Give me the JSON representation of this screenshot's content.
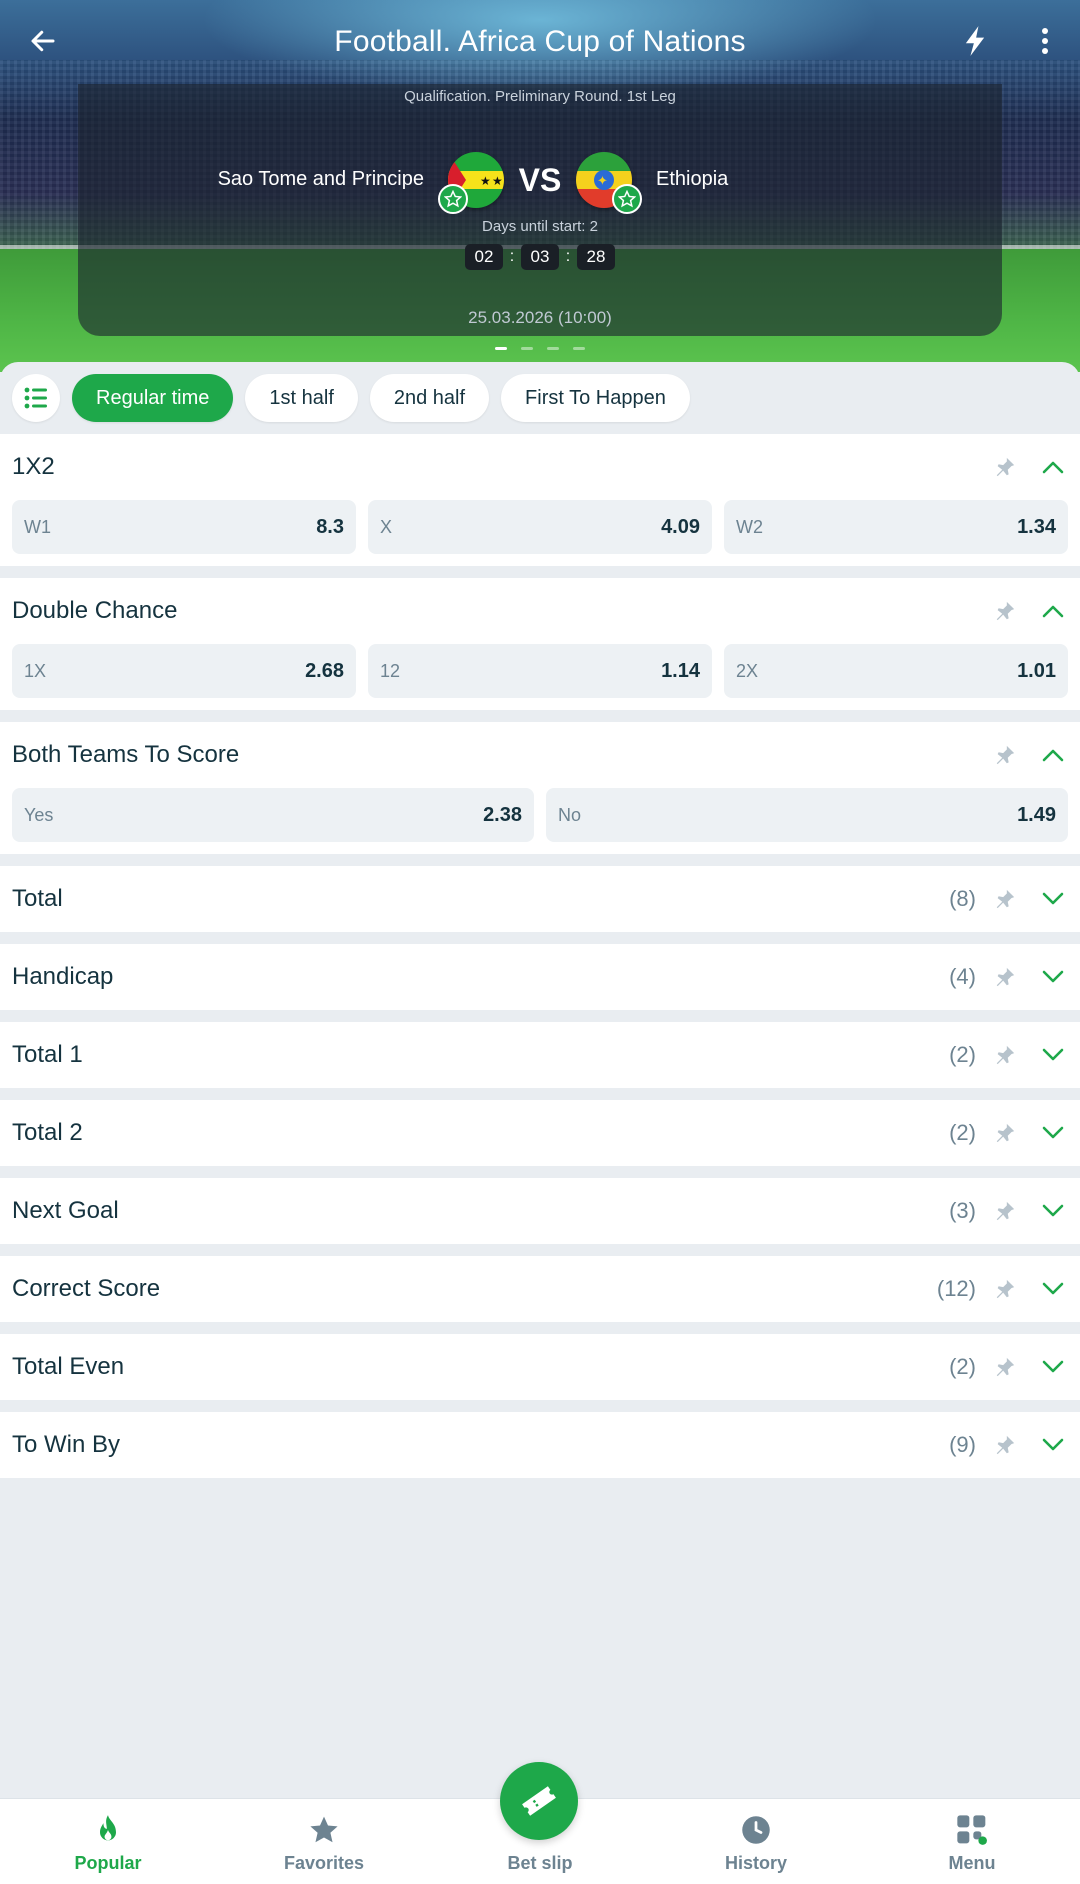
{
  "header": {
    "title": "Football. Africa Cup of Nations",
    "round": "Qualification. Preliminary Round. 1st Leg"
  },
  "match": {
    "team1": "Sao Tome and Principe",
    "team2": "Ethiopia",
    "vs": "VS",
    "days_until": "Days until start: 2",
    "countdown": [
      "02",
      "03",
      "28"
    ],
    "date": "25.03.2026 (10:00)",
    "carousel_pages": 4,
    "carousel_active": 1
  },
  "tabs": [
    {
      "label": "Regular time",
      "active": true
    },
    {
      "label": "1st half",
      "active": false
    },
    {
      "label": "2nd half",
      "active": false
    },
    {
      "label": "First To Happen",
      "active": false
    }
  ],
  "markets": [
    {
      "name": "1X2",
      "expanded": true,
      "odds": [
        {
          "label": "W1",
          "value": "8.3"
        },
        {
          "label": "X",
          "value": "4.09"
        },
        {
          "label": "W2",
          "value": "1.34"
        }
      ]
    },
    {
      "name": "Double Chance",
      "expanded": true,
      "odds": [
        {
          "label": "1X",
          "value": "2.68"
        },
        {
          "label": "12",
          "value": "1.14"
        },
        {
          "label": "2X",
          "value": "1.01"
        }
      ]
    },
    {
      "name": "Both Teams To Score",
      "expanded": true,
      "odds": [
        {
          "label": "Yes",
          "value": "2.38"
        },
        {
          "label": "No",
          "value": "1.49"
        }
      ]
    },
    {
      "name": "Total",
      "expanded": false,
      "count": "(8)"
    },
    {
      "name": "Handicap",
      "expanded": false,
      "count": "(4)"
    },
    {
      "name": "Total 1",
      "expanded": false,
      "count": "(2)"
    },
    {
      "name": "Total 2",
      "expanded": false,
      "count": "(2)"
    },
    {
      "name": "Next Goal",
      "expanded": false,
      "count": "(3)"
    },
    {
      "name": "Correct Score",
      "expanded": false,
      "count": "(12)"
    },
    {
      "name": "Total Even",
      "expanded": false,
      "count": "(2)"
    },
    {
      "name": "To Win By",
      "expanded": false,
      "count": "(9)"
    }
  ],
  "bottom_nav": [
    {
      "label": "Popular",
      "icon": "flame-icon",
      "active": true
    },
    {
      "label": "Favorites",
      "icon": "star-icon",
      "active": false
    },
    {
      "label": "Bet slip",
      "icon": "ticket-icon",
      "active": false
    },
    {
      "label": "History",
      "icon": "clock-icon",
      "active": false
    },
    {
      "label": "Menu",
      "icon": "grid-icon",
      "active": false
    }
  ],
  "colors": {
    "accent": "#1ea84a",
    "text": "#15333f",
    "muted": "#6d8391",
    "background": "#e9edf1"
  }
}
